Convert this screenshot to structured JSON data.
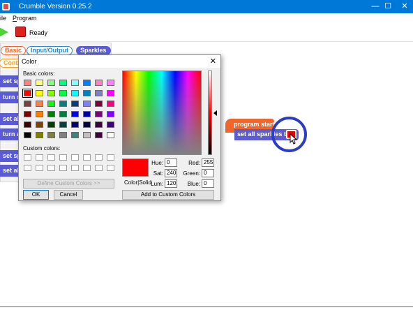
{
  "window": {
    "title": "Crumble Version 0.25.2",
    "minimize": "—",
    "maximize": "☐",
    "close": "✕"
  },
  "menu": {
    "file": "ile",
    "program_ul": "P",
    "program_rest": "rogram"
  },
  "toolbar": {
    "status": "Ready"
  },
  "palette": {
    "tabs": {
      "basic": "Basic",
      "io": "Input/Output",
      "sparkles": "Sparkles",
      "control": "Contr"
    },
    "blocks": [
      "set sp",
      "turn s",
      "set all",
      "turn a",
      "set sp",
      "set all"
    ]
  },
  "workspace": {
    "program_start": "program start",
    "set_all_sparkles": "set all sparkles to",
    "block_color": "#e00000"
  },
  "dialog": {
    "title": "Color",
    "close": "✕",
    "basic_colors_label": "Basic colors:",
    "custom_colors_label": "Custom colors:",
    "define_button": "Define Custom Colors >>",
    "ok_button": "OK",
    "cancel_button": "Cancel",
    "color_solid_label": "Color|Solid",
    "add_button": "Add to Custom Colors",
    "fields": {
      "hue_label": "Hue:",
      "hue": "0",
      "sat_label": "Sat:",
      "sat": "240",
      "lum_label": "Lum:",
      "lum": "120",
      "red_label": "Red:",
      "red": "255",
      "green_label": "Green:",
      "green": "0",
      "blue_label": "Blue:",
      "blue": "0"
    },
    "basic_colors": [
      [
        "#ff8080",
        "#ffff80",
        "#80ff80",
        "#00ff80",
        "#80ffff",
        "#0080ff",
        "#ff80c0",
        "#ff80ff"
      ],
      [
        "#ff0000",
        "#ffff00",
        "#80ff00",
        "#00ff40",
        "#00ffff",
        "#0080c0",
        "#8080c0",
        "#ff00ff"
      ],
      [
        "#804040",
        "#ff8040",
        "#00ff00",
        "#008080",
        "#004080",
        "#8080ff",
        "#800040",
        "#ff0080"
      ],
      [
        "#800000",
        "#ff8000",
        "#008000",
        "#008040",
        "#0000ff",
        "#0000a0",
        "#800080",
        "#8000ff"
      ],
      [
        "#400000",
        "#804000",
        "#004000",
        "#004040",
        "#000080",
        "#000040",
        "#400040",
        "#400080"
      ],
      [
        "#000000",
        "#808000",
        "#808040",
        "#808080",
        "#408080",
        "#c0c0c0",
        "#400040",
        "#ffffff"
      ]
    ],
    "selected_index": [
      1,
      0
    ]
  },
  "colors": {
    "titlebar": "#0078d7",
    "accent": "#2b3ec2",
    "block_purple": "#5b5bd6",
    "block_orange": "#f2662b"
  }
}
